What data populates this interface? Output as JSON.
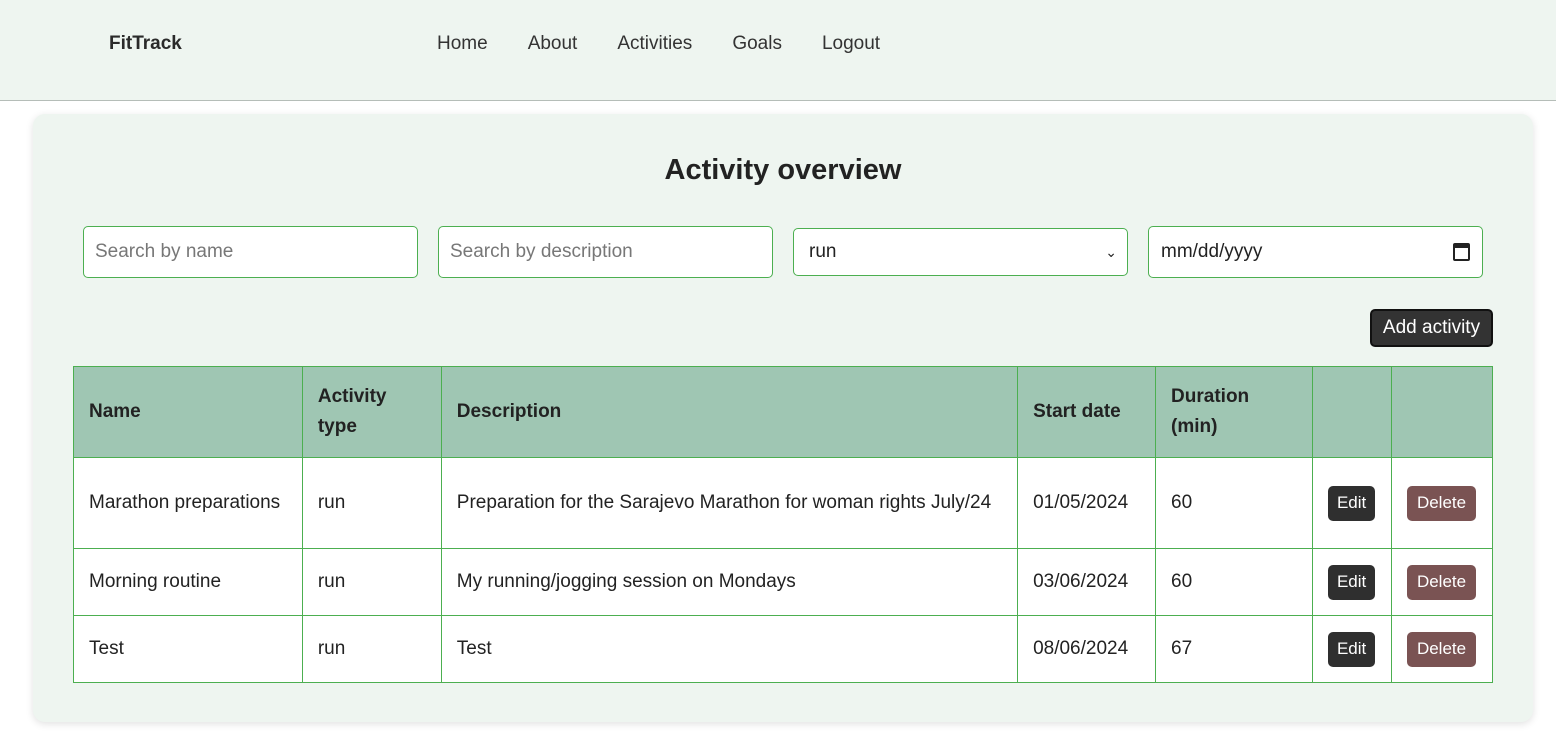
{
  "nav": {
    "brand": "FitTrack",
    "links": [
      "Home",
      "About",
      "Activities",
      "Goals",
      "Logout"
    ]
  },
  "main": {
    "title": "Activity overview",
    "filters": {
      "name_placeholder": "Search by name",
      "description_placeholder": "Search by description",
      "type_selected": "run",
      "date_placeholder": "mm/dd/yyyy"
    },
    "add_button": "Add activity",
    "table": {
      "headers": [
        "Name",
        "Activity type",
        "Description",
        "Start date",
        "Duration (min)",
        "",
        ""
      ],
      "rows": [
        {
          "name": "Marathon preparations",
          "type": "run",
          "description": "Preparation for the Sarajevo Marathon for woman rights July/24",
          "start_date": "01/05/2024",
          "duration": "60",
          "edit": "Edit",
          "delete": "Delete"
        },
        {
          "name": "Morning routine",
          "type": "run",
          "description": "My running/jogging session on Mondays",
          "start_date": "03/06/2024",
          "duration": "60",
          "edit": "Edit",
          "delete": "Delete"
        },
        {
          "name": "Test",
          "type": "run",
          "description": "Test",
          "start_date": "08/06/2024",
          "duration": "67",
          "edit": "Edit",
          "delete": "Delete"
        }
      ]
    }
  },
  "icons": {
    "select_arrow": "chevron-down-icon",
    "date_picker": "calendar-icon"
  },
  "colors": {
    "nav_bg": "#eef5f0",
    "header_bg": "#9fc6b3",
    "border": "#4caf50",
    "edit_button": "#2f2f2f",
    "delete_button": "#7a5353"
  }
}
